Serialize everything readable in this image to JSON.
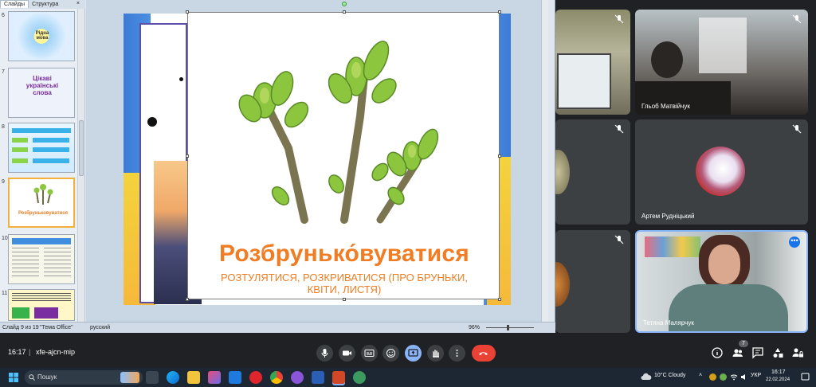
{
  "ppt": {
    "tabs": [
      "Слайды",
      "Структура"
    ],
    "close": "×",
    "slide_numbers": [
      "6",
      "7",
      "8",
      "9",
      "10",
      "11"
    ],
    "thumb7_text": "Цікаві українські слова",
    "thumb6_text": "Рідна мова",
    "thumb9_text": "Розбруньковуватися",
    "status": {
      "slide_of": "Слайд 9 из 19",
      "theme": "\"Тема Office\"",
      "language": "русский",
      "zoom": "96%"
    },
    "slide": {
      "word": "Розбрунько́вуватися",
      "definition": "РОЗТУЛЯТИСЯ, РОЗКРИВАТИСЯ (ПРО БРУНЬКИ, КВІТИ, ЛИСТЯ)"
    }
  },
  "meet": {
    "participants": [
      {
        "name": ""
      },
      {
        "name": "Гльоб Матвійчук"
      },
      {
        "name": ""
      },
      {
        "name": "Артем Рудніцький"
      },
      {
        "name": ""
      },
      {
        "name": "Тетяна Малярчук"
      }
    ],
    "time": "16:17",
    "separator": "|",
    "code": "xfe-ajcn-mip",
    "people_count": "7",
    "more": "•••"
  },
  "taskbar": {
    "search_placeholder": "Пошук",
    "weather": "10°C Cloudy",
    "language": "УКР",
    "time": "16:17",
    "date": "22.02.2024"
  },
  "colors": {
    "accent_orange": "#f07d23",
    "meet_bg": "#202124",
    "end_call": "#ea4335",
    "present_active": "#8ab4f8"
  }
}
